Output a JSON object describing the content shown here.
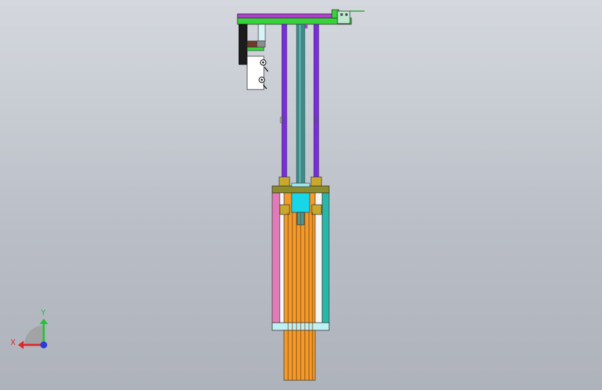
{
  "triad": {
    "x_label": "X",
    "y_label": "Y",
    "x_color": "#e0262a",
    "y_color": "#27c23a",
    "z_color": "#2a3bd8"
  },
  "colors": {
    "background_top": "#d4d8de",
    "background_bottom": "#aeb3bb",
    "top_bar": "#b13fd0",
    "top_plate": "#37d33a",
    "guide_rod": "#7a2fd6",
    "center_shaft": "#3d8c8a",
    "housing_plate": "#8c8c2c",
    "left_wall": "#e27ab8",
    "right_wall": "#2ab6a8",
    "body": "#f39a2a",
    "bushing": "#c9a82c",
    "piston": "#18d6e8",
    "bottom_plate": "#bff0f3"
  },
  "icons": {
    "triad": "xyz-triad-icon"
  }
}
